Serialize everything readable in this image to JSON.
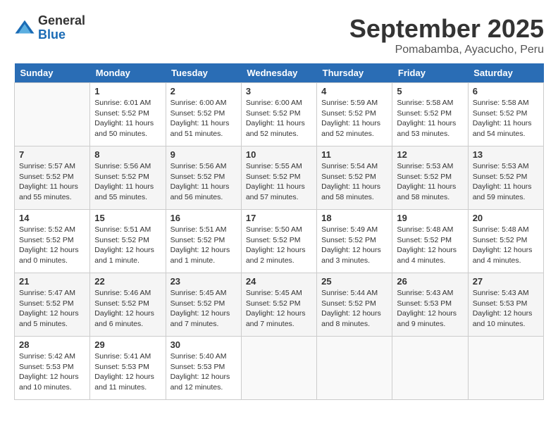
{
  "header": {
    "logo": {
      "general": "General",
      "blue": "Blue"
    },
    "title": "September 2025",
    "location": "Pomabamba, Ayacucho, Peru"
  },
  "days_of_week": [
    "Sunday",
    "Monday",
    "Tuesday",
    "Wednesday",
    "Thursday",
    "Friday",
    "Saturday"
  ],
  "weeks": [
    [
      {
        "day": "",
        "info": ""
      },
      {
        "day": "1",
        "info": "Sunrise: 6:01 AM\nSunset: 5:52 PM\nDaylight: 11 hours\nand 50 minutes."
      },
      {
        "day": "2",
        "info": "Sunrise: 6:00 AM\nSunset: 5:52 PM\nDaylight: 11 hours\nand 51 minutes."
      },
      {
        "day": "3",
        "info": "Sunrise: 6:00 AM\nSunset: 5:52 PM\nDaylight: 11 hours\nand 52 minutes."
      },
      {
        "day": "4",
        "info": "Sunrise: 5:59 AM\nSunset: 5:52 PM\nDaylight: 11 hours\nand 52 minutes."
      },
      {
        "day": "5",
        "info": "Sunrise: 5:58 AM\nSunset: 5:52 PM\nDaylight: 11 hours\nand 53 minutes."
      },
      {
        "day": "6",
        "info": "Sunrise: 5:58 AM\nSunset: 5:52 PM\nDaylight: 11 hours\nand 54 minutes."
      }
    ],
    [
      {
        "day": "7",
        "info": "Sunrise: 5:57 AM\nSunset: 5:52 PM\nDaylight: 11 hours\nand 55 minutes."
      },
      {
        "day": "8",
        "info": "Sunrise: 5:56 AM\nSunset: 5:52 PM\nDaylight: 11 hours\nand 55 minutes."
      },
      {
        "day": "9",
        "info": "Sunrise: 5:56 AM\nSunset: 5:52 PM\nDaylight: 11 hours\nand 56 minutes."
      },
      {
        "day": "10",
        "info": "Sunrise: 5:55 AM\nSunset: 5:52 PM\nDaylight: 11 hours\nand 57 minutes."
      },
      {
        "day": "11",
        "info": "Sunrise: 5:54 AM\nSunset: 5:52 PM\nDaylight: 11 hours\nand 58 minutes."
      },
      {
        "day": "12",
        "info": "Sunrise: 5:53 AM\nSunset: 5:52 PM\nDaylight: 11 hours\nand 58 minutes."
      },
      {
        "day": "13",
        "info": "Sunrise: 5:53 AM\nSunset: 5:52 PM\nDaylight: 11 hours\nand 59 minutes."
      }
    ],
    [
      {
        "day": "14",
        "info": "Sunrise: 5:52 AM\nSunset: 5:52 PM\nDaylight: 12 hours\nand 0 minutes."
      },
      {
        "day": "15",
        "info": "Sunrise: 5:51 AM\nSunset: 5:52 PM\nDaylight: 12 hours\nand 1 minute."
      },
      {
        "day": "16",
        "info": "Sunrise: 5:51 AM\nSunset: 5:52 PM\nDaylight: 12 hours\nand 1 minute."
      },
      {
        "day": "17",
        "info": "Sunrise: 5:50 AM\nSunset: 5:52 PM\nDaylight: 12 hours\nand 2 minutes."
      },
      {
        "day": "18",
        "info": "Sunrise: 5:49 AM\nSunset: 5:52 PM\nDaylight: 12 hours\nand 3 minutes."
      },
      {
        "day": "19",
        "info": "Sunrise: 5:48 AM\nSunset: 5:52 PM\nDaylight: 12 hours\nand 4 minutes."
      },
      {
        "day": "20",
        "info": "Sunrise: 5:48 AM\nSunset: 5:52 PM\nDaylight: 12 hours\nand 4 minutes."
      }
    ],
    [
      {
        "day": "21",
        "info": "Sunrise: 5:47 AM\nSunset: 5:52 PM\nDaylight: 12 hours\nand 5 minutes."
      },
      {
        "day": "22",
        "info": "Sunrise: 5:46 AM\nSunset: 5:52 PM\nDaylight: 12 hours\nand 6 minutes."
      },
      {
        "day": "23",
        "info": "Sunrise: 5:45 AM\nSunset: 5:52 PM\nDaylight: 12 hours\nand 7 minutes."
      },
      {
        "day": "24",
        "info": "Sunrise: 5:45 AM\nSunset: 5:52 PM\nDaylight: 12 hours\nand 7 minutes."
      },
      {
        "day": "25",
        "info": "Sunrise: 5:44 AM\nSunset: 5:52 PM\nDaylight: 12 hours\nand 8 minutes."
      },
      {
        "day": "26",
        "info": "Sunrise: 5:43 AM\nSunset: 5:53 PM\nDaylight: 12 hours\nand 9 minutes."
      },
      {
        "day": "27",
        "info": "Sunrise: 5:43 AM\nSunset: 5:53 PM\nDaylight: 12 hours\nand 10 minutes."
      }
    ],
    [
      {
        "day": "28",
        "info": "Sunrise: 5:42 AM\nSunset: 5:53 PM\nDaylight: 12 hours\nand 10 minutes."
      },
      {
        "day": "29",
        "info": "Sunrise: 5:41 AM\nSunset: 5:53 PM\nDaylight: 12 hours\nand 11 minutes."
      },
      {
        "day": "30",
        "info": "Sunrise: 5:40 AM\nSunset: 5:53 PM\nDaylight: 12 hours\nand 12 minutes."
      },
      {
        "day": "",
        "info": ""
      },
      {
        "day": "",
        "info": ""
      },
      {
        "day": "",
        "info": ""
      },
      {
        "day": "",
        "info": ""
      }
    ]
  ]
}
